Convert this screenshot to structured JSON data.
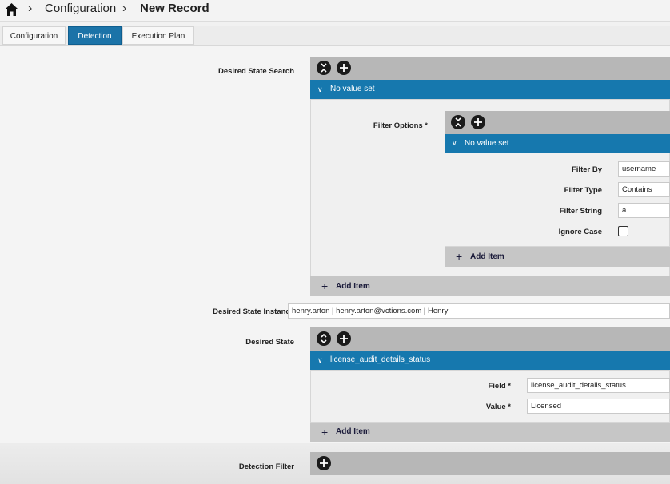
{
  "breadcrumb": {
    "level1": "Configuration",
    "level2": "New Record"
  },
  "tabs": [
    {
      "label": "Configuration",
      "active": false
    },
    {
      "label": "Detection",
      "active": true
    },
    {
      "label": "Execution Plan",
      "active": false
    }
  ],
  "desired_state_search": {
    "label": "Desired State Search",
    "value_header": "No value set",
    "filter_options": {
      "label": "Filter Options *",
      "value_header": "No value set",
      "filter_by": {
        "label": "Filter By",
        "value": "username"
      },
      "filter_type": {
        "label": "Filter Type",
        "value": "Contains"
      },
      "filter_string": {
        "label": "Filter String",
        "value": "a"
      },
      "ignore_case": {
        "label": "Ignore Case",
        "checked": false
      },
      "add_item_label": "Add Item"
    },
    "add_item_label": "Add Item"
  },
  "desired_state_instance": {
    "label": "Desired State Instance",
    "value": "henry.arton | henry.arton@vctions.com | Henry"
  },
  "desired_state": {
    "label": "Desired State",
    "value_header": "license_audit_details_status",
    "field": {
      "label": "Field *",
      "value": "license_audit_details_status"
    },
    "value": {
      "label": "Value *",
      "value": "Licensed"
    },
    "add_item_label": "Add Item"
  },
  "detection_filter": {
    "label": "Detection Filter"
  },
  "colors": {
    "accent": "#1678ae",
    "tab_active": "#1b73a8",
    "bar_gray": "#b7b7b7"
  }
}
